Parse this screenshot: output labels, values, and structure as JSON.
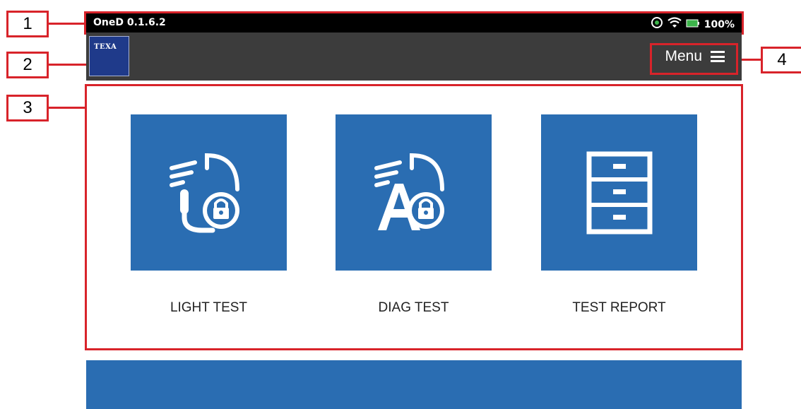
{
  "status_bar": {
    "version": "OneD 0.1.6.2",
    "battery": "100%",
    "icons": [
      "location-icon",
      "wifi-icon",
      "battery-icon"
    ]
  },
  "header": {
    "logo_text": "TEXA",
    "menu_label": "Menu"
  },
  "tiles": [
    {
      "label": "LIGHT TEST",
      "icon": "light-test-icon"
    },
    {
      "label": "DIAG TEST",
      "icon": "diag-test-icon"
    },
    {
      "label": "TEST REPORT",
      "icon": "cabinet-icon"
    }
  ],
  "callouts": [
    "1",
    "2",
    "3",
    "4"
  ],
  "colors": {
    "tile_blue": "#2a6db2",
    "header_gray": "#3c3c3c",
    "callout_red": "#d8232a",
    "battery_green": "#3cb44a"
  }
}
